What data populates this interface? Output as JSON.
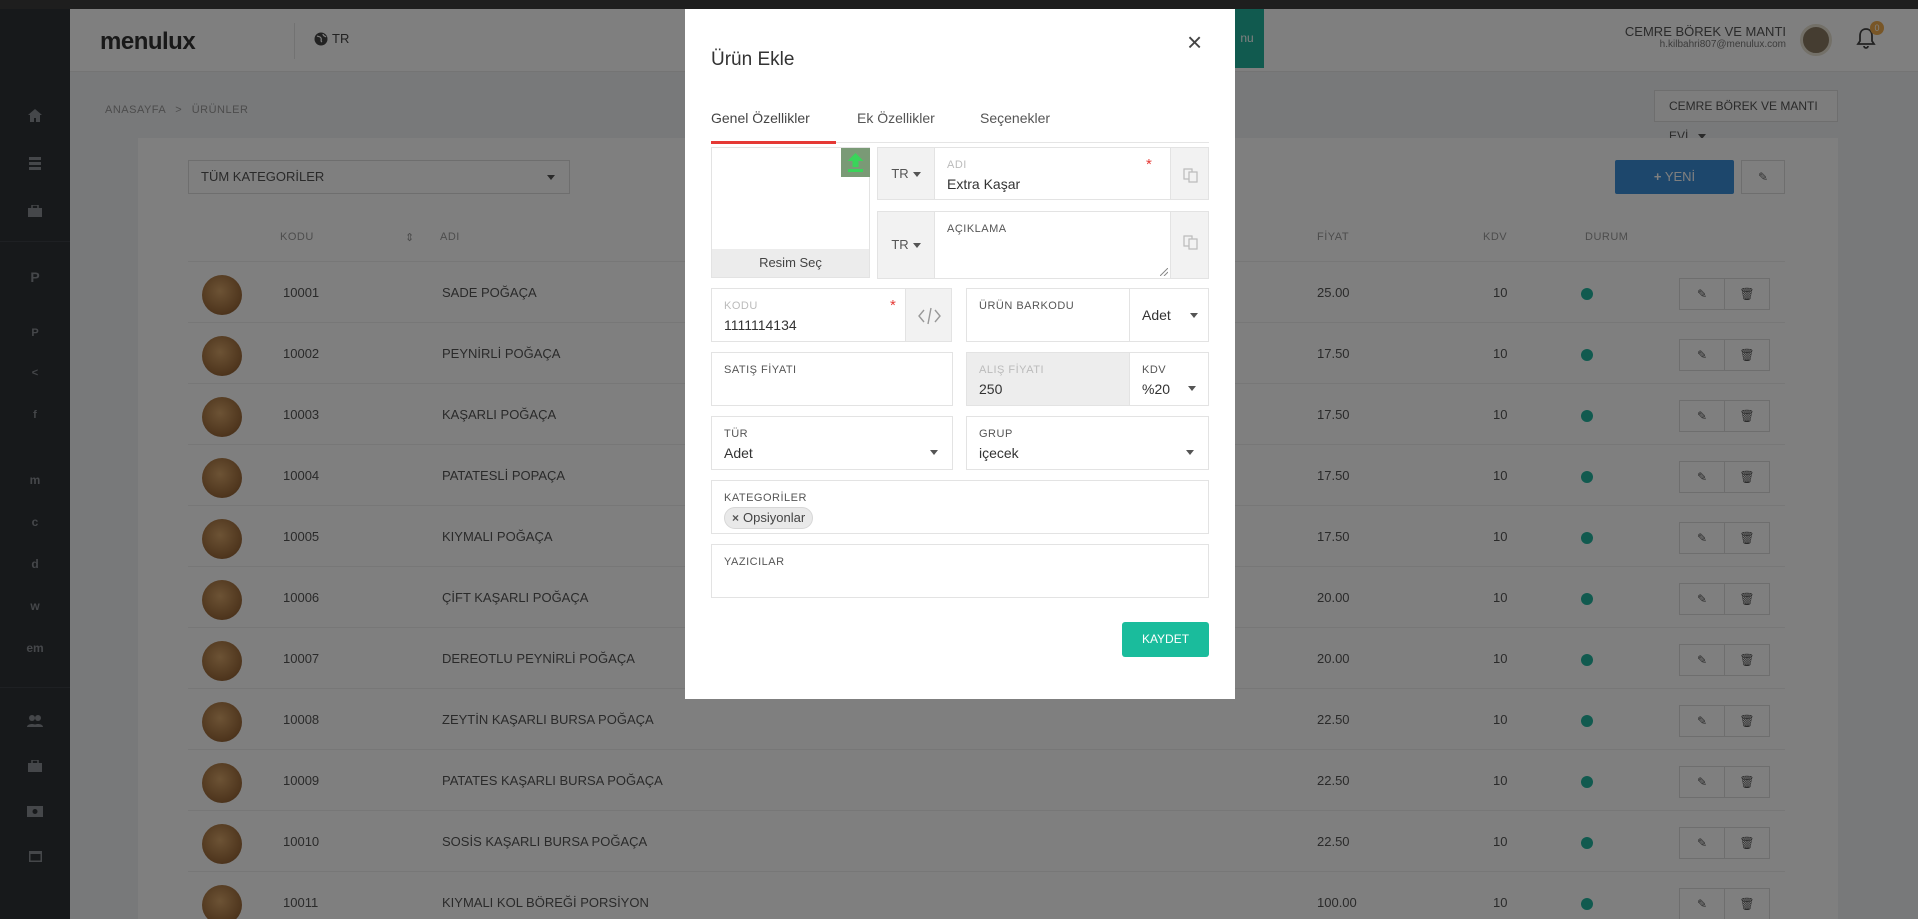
{
  "header": {
    "logo": "menulux",
    "lang": "TR",
    "user_name": "CEMRE BÖREK VE MANTI",
    "user_email": "h.kilbahri807@menulux.com",
    "notification_count": "0",
    "teal_button_label": "nu"
  },
  "sidebar": {
    "items": [
      "P",
      "P",
      "<",
      "f",
      "m",
      "c",
      "d",
      "w",
      "em"
    ]
  },
  "breadcrumb": {
    "home": "ANASAYFA",
    "sep": ">",
    "current": "ÜRÜNLER"
  },
  "store_select": "CEMRE BÖREK VE MANTI EVİ",
  "filters": {
    "category": "TÜM KATEGORİLER"
  },
  "toolbar": {
    "new_label": "YENİ"
  },
  "table": {
    "columns": {
      "code": "KODU",
      "name": "ADI",
      "price": "FİYAT",
      "kdv": "KDV",
      "status": "DURUM"
    },
    "rows": [
      {
        "code": "10001",
        "name": "SADE POĞAÇA",
        "price": "25.00",
        "kdv": "10"
      },
      {
        "code": "10002",
        "name": "PEYNİRLİ POĞAÇA",
        "price": "17.50",
        "kdv": "10"
      },
      {
        "code": "10003",
        "name": "KAŞARLI POĞAÇA",
        "price": "17.50",
        "kdv": "10"
      },
      {
        "code": "10004",
        "name": "PATATESLİ POPAÇA",
        "price": "17.50",
        "kdv": "10"
      },
      {
        "code": "10005",
        "name": "KIYMALI POĞAÇA",
        "price": "17.50",
        "kdv": "10"
      },
      {
        "code": "10006",
        "name": "ÇİFT KAŞARLI POĞAÇA",
        "price": "20.00",
        "kdv": "10"
      },
      {
        "code": "10007",
        "name": "DEREOTLU PEYNİRLİ POĞAÇA",
        "price": "20.00",
        "kdv": "10"
      },
      {
        "code": "10008",
        "name": "ZEYTİN KAŞARLI BURSA POĞAÇA",
        "price": "22.50",
        "kdv": "10"
      },
      {
        "code": "10009",
        "name": "PATATES KAŞARLI BURSA POĞAÇA",
        "price": "22.50",
        "kdv": "10"
      },
      {
        "code": "10010",
        "name": "SOSİS KAŞARLI BURSA POĞAÇA",
        "price": "22.50",
        "kdv": "10"
      },
      {
        "code": "10011",
        "name": "KIYMALI KOL BÖREĞİ PORSİYON",
        "price": "100.00",
        "kdv": "10"
      }
    ]
  },
  "modal": {
    "title": "Ürün Ekle",
    "close": "×",
    "tabs": [
      "Genel Özellikler",
      "Ek Özellikler",
      "Seçenekler"
    ],
    "image_button": "Resim Seç",
    "name_lang": "TR",
    "name_label": "ADI",
    "name_value": "Extra Kaşar",
    "desc_lang": "TR",
    "desc_label": "AÇIKLAMA",
    "code_label": "KODU",
    "code_value": "1111114134",
    "barcode_label": "ÜRÜN BARKODU",
    "unit_value": "Adet",
    "sale_price_label": "SATIŞ FİYATI",
    "purchase_price_label": "ALIŞ FİYATI",
    "purchase_price_value": "250",
    "kdv_label": "KDV",
    "kdv_value": "%20",
    "type_label": "TÜR",
    "type_value": "Adet",
    "group_label": "GRUP",
    "group_value": "içecek",
    "categories_label": "KATEGORİLER",
    "category_chip": "Opsiyonlar",
    "printers_label": "YAZICILAR",
    "save_label": "KAYDET",
    "required_mark": "*"
  },
  "colors": {
    "accent": "#1abc9c",
    "tab_underline": "#e53935",
    "new_button": "#3b8fd8"
  }
}
